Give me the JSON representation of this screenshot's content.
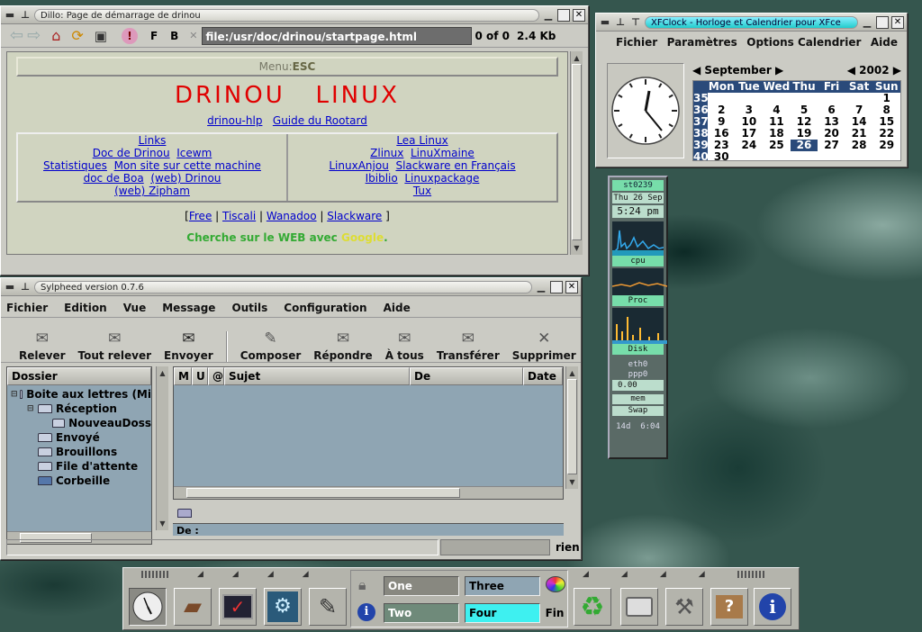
{
  "dillo": {
    "title": "Dillo: Page de démarrage de drinou",
    "url": "file:/usr/doc/drinou/startpage.html",
    "counter": "0 of 0",
    "size": "2.4 Kb",
    "btn_f": "F",
    "btn_b": "B",
    "btn_x": "✕",
    "menu_label": "Menu:",
    "menu_key": "ESC",
    "heading": "DRINOU   LINUX",
    "top_links": [
      "drinou-hlp",
      "Guide du Rootard"
    ],
    "links_header": "Links",
    "left_links": [
      "Doc de Drinou",
      "Icewm",
      "Statistiques",
      "Mon site sur cette machine",
      "doc de Boa",
      "(web) Drinou",
      "(web) Zipham"
    ],
    "right_header": "Lea Linux",
    "right_links": [
      "Zlinux",
      "LinuXmaine",
      "LinuxAnjou",
      "Slackware en Français",
      "Ibiblio",
      "Linuxpackage",
      "Tux"
    ],
    "bottom_links": [
      "Free",
      "Tiscali",
      "Wanadoo",
      "Slackware"
    ],
    "bracket_open": "[",
    "bracket_close": " ]",
    "pipe": " | ",
    "search_text": "Cherche sur le WEB avec ",
    "search_engine": "Google",
    "search_end": "."
  },
  "xfclock": {
    "title": "XFClock - Horloge et Calendrier pour XFce",
    "menu": [
      "Fichier",
      "Paramètres",
      "Options Calendrier",
      "Aide"
    ],
    "month": "September",
    "year": "2002",
    "days": [
      "Mon",
      "Tue",
      "Wed",
      "Thu",
      "Fri",
      "Sat",
      "Sun"
    ],
    "weeks": [
      {
        "wk": "35",
        "d": [
          "",
          "",
          "",
          "",
          "",
          "",
          "1"
        ]
      },
      {
        "wk": "36",
        "d": [
          "2",
          "3",
          "4",
          "5",
          "6",
          "7",
          "8"
        ]
      },
      {
        "wk": "37",
        "d": [
          "9",
          "10",
          "11",
          "12",
          "13",
          "14",
          "15"
        ]
      },
      {
        "wk": "38",
        "d": [
          "16",
          "17",
          "18",
          "19",
          "20",
          "21",
          "22"
        ]
      },
      {
        "wk": "39",
        "d": [
          "23",
          "24",
          "25",
          "26",
          "27",
          "28",
          "29"
        ]
      },
      {
        "wk": "40",
        "d": [
          "30",
          "",
          "",
          "",
          "",
          "",
          ""
        ]
      }
    ],
    "today": "26"
  },
  "monitor": {
    "host": "st0239",
    "date": "Thu 26 Sep",
    "time": "5:24 pm",
    "labels": [
      "cpu",
      "Proc",
      "Disk"
    ],
    "eth": "eth0",
    "ppp": "ppp0",
    "net_val": "0.00",
    "mem": "mem",
    "swap": "Swap",
    "uptime": "14d  6:04"
  },
  "sylpheed": {
    "title": "Sylpheed version 0.7.6",
    "menu": [
      "Fichier",
      "Edition",
      "Vue",
      "Message",
      "Outils",
      "Configuration",
      "Aide"
    ],
    "toolbar": [
      "Relever",
      "Tout relever",
      "Envoyer",
      "Composer",
      "Répondre",
      "À tous",
      "Transférer",
      "Supprimer"
    ],
    "folder_header": "Dossier",
    "folders": [
      {
        "name": "Boite aux lettres (Mi",
        "level": 0
      },
      {
        "name": "Réception",
        "level": 1
      },
      {
        "name": "NouveauDoss",
        "level": 2
      },
      {
        "name": "Envoyé",
        "level": 1
      },
      {
        "name": "Brouillons",
        "level": 1
      },
      {
        "name": "File d'attente",
        "level": 1
      },
      {
        "name": "Corbeille",
        "level": 1
      }
    ],
    "columns": [
      "M",
      "U",
      "@",
      "Sujet",
      "De",
      "Date"
    ],
    "de_label": "De :",
    "status": "rien"
  },
  "panel": {
    "workspaces": [
      "One",
      "Three",
      "Two",
      "Four"
    ],
    "active_workspace": "Four",
    "fin": "Fin",
    "icons": [
      "clock-icon",
      "file-manager-icon",
      "terminal-icon",
      "network-icon",
      "editor-icon",
      "recycle-icon",
      "printer-icon",
      "settings-icon",
      "package-icon",
      "info-icon"
    ]
  },
  "colors": {
    "accent": "#2a4a7a",
    "cyan": "#3ef0f0",
    "heading": "#e00000",
    "search": "#33aa33",
    "google": "#dddd33"
  }
}
